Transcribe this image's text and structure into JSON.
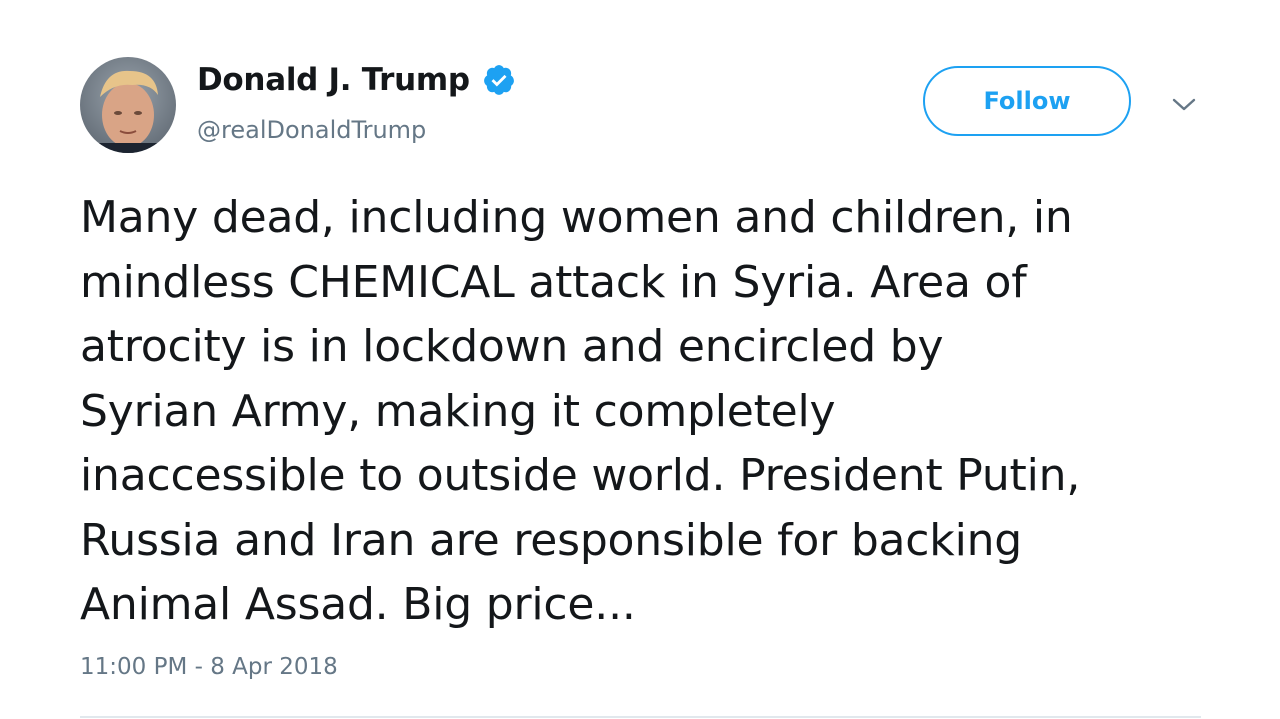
{
  "tweet": {
    "author": {
      "display_name": "Donald J. Trump",
      "handle": "@realDonaldTrump",
      "verified": true,
      "avatar_icon": "profile-photo"
    },
    "follow_label": "Follow",
    "menu_icon": "chevron-down-icon",
    "text_lines": [
      "Many dead, including women and children, in",
      "mindless CHEMICAL attack in Syria. Area of",
      "atrocity is in lockdown and encircled by",
      "Syrian Army, making it completely",
      "inaccessible to outside world. President Putin,",
      "Russia and Iran are responsible for backing",
      "Animal Assad. Big price..."
    ],
    "timestamp": "11:00 PM - 8 Apr 2018"
  },
  "colors": {
    "accent": "#1da1f2",
    "text": "#14171a",
    "secondary_text": "#657786",
    "divider": "#e1e8ed"
  }
}
